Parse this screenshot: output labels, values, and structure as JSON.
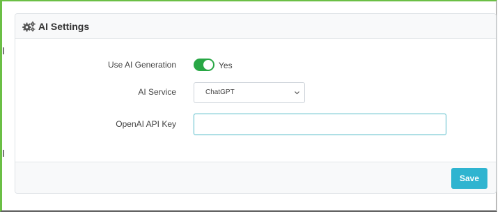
{
  "panel": {
    "title": "AI Settings",
    "icon": "gears-icon"
  },
  "fields": {
    "ai_generation": {
      "label": "Use AI Generation",
      "enabled": true,
      "state_text": "Yes"
    },
    "ai_service": {
      "label": "AI Service",
      "selected": "ChatGPT"
    },
    "api_key": {
      "label": "OpenAI API Key",
      "value": "",
      "placeholder": ""
    }
  },
  "footer": {
    "save_label": "Save"
  },
  "colors": {
    "toggle_on": "#28a745",
    "save_button": "#2fb4d0",
    "input_focus_border": "#66c2cf",
    "frame_accent": "#6bbf45"
  }
}
